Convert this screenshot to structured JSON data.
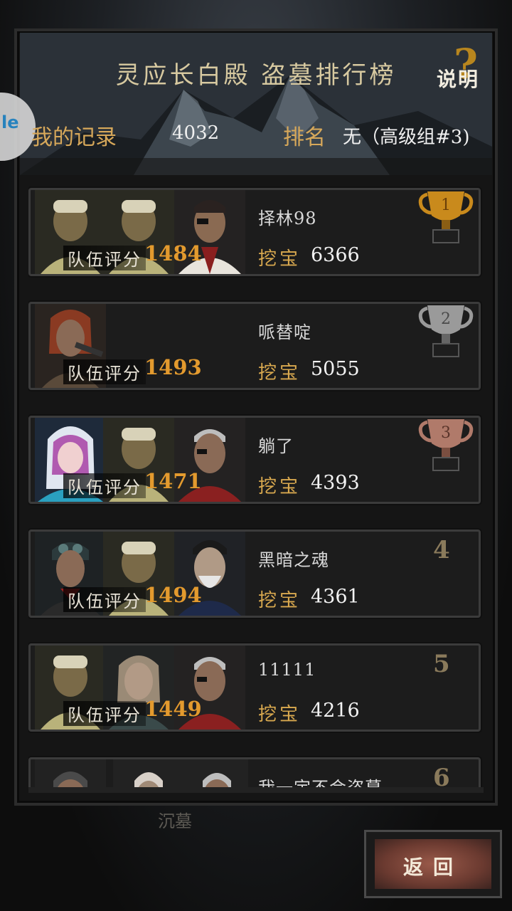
{
  "header": {
    "title": "灵应长白殿 盗墓排行榜",
    "help_label": "说明",
    "help_mark": "?",
    "side_tab_label": "le"
  },
  "my_record": {
    "label": "我的记录",
    "value": "4032",
    "rank_label": "排名",
    "rank_value": "无（高级组#3)"
  },
  "entries": [
    {
      "rank": "1",
      "player": "择林98",
      "team_label": "队伍评分",
      "team_score": "1484",
      "dig_label": "挖宝",
      "dig_value": "6366",
      "trophy": "gold"
    },
    {
      "rank": "2",
      "player": "哌替啶",
      "team_label": "队伍评分",
      "team_score": "1493",
      "dig_label": "挖宝",
      "dig_value": "5055",
      "trophy": "silver"
    },
    {
      "rank": "3",
      "player": "躺了",
      "team_label": "队伍评分",
      "team_score": "1471",
      "dig_label": "挖宝",
      "dig_value": "4393",
      "trophy": "bronze"
    },
    {
      "rank": "4",
      "player": "黑暗之魂",
      "team_label": "队伍评分",
      "team_score": "1494",
      "dig_label": "挖宝",
      "dig_value": "4361"
    },
    {
      "rank": "5",
      "player": "11111",
      "team_label": "队伍评分",
      "team_score": "1449",
      "dig_label": "挖宝",
      "dig_value": "4216"
    },
    {
      "rank": "6",
      "player": "我一定不会盗墓"
    }
  ],
  "under_text": "沉墓",
  "back_button": "返回",
  "colors": {
    "gold": "#c98a1c",
    "silver": "#9a9a9a",
    "bronze": "#b07a6a",
    "accent": "#d9a94f",
    "score": "#e39a2e"
  }
}
